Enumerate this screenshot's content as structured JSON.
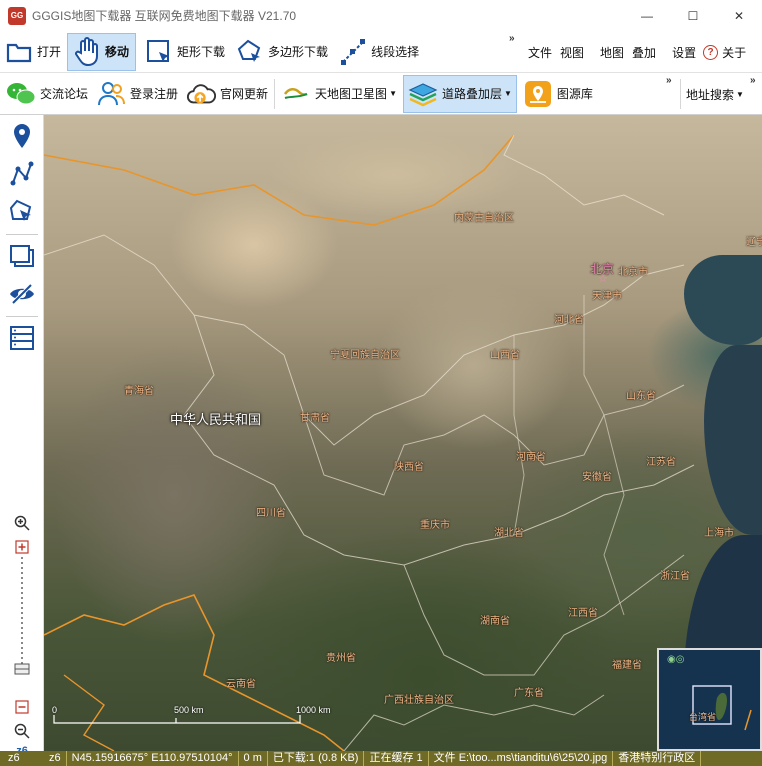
{
  "window": {
    "title": "GGGIS地图下载器  互联网免费地图下载器 V21.70",
    "logo_text": "GG",
    "minimize": "—",
    "maximize": "☐",
    "close": "✕"
  },
  "toolbar": {
    "open": "打开",
    "move": "移动",
    "rect_download": "矩形下载",
    "polygon_download": "多边形下载",
    "line_select": "线段选择",
    "more": "»",
    "file": "文件",
    "view": "视图",
    "map": "地图",
    "overlay": "叠加",
    "settings": "设置",
    "about": "关于"
  },
  "toolbar2": {
    "forum": "交流论坛",
    "login": "登录注册",
    "update": "官网更新",
    "tianditu": "天地图卫星图",
    "road_overlay": "道路叠加层",
    "tile_library": "图源库",
    "more": "»",
    "address_search": "地址搜索",
    "more2": "»"
  },
  "sidebar": {
    "zoom_level": "z6"
  },
  "map": {
    "labels": [
      {
        "text": "内蒙古自治区",
        "type": "province"
      },
      {
        "text": "北京",
        "type": "capital"
      },
      {
        "text": "北京市",
        "type": "province"
      },
      {
        "text": "天津市",
        "type": "province"
      },
      {
        "text": "辽宁",
        "type": "province"
      },
      {
        "text": "河北省",
        "type": "province"
      },
      {
        "text": "宁夏回族自治区",
        "type": "province"
      },
      {
        "text": "山西省",
        "type": "province"
      },
      {
        "text": "山东省",
        "type": "province"
      },
      {
        "text": "青海省",
        "type": "province"
      },
      {
        "text": "中华人民共和国",
        "type": "country"
      },
      {
        "text": "甘肃省",
        "type": "province"
      },
      {
        "text": "陕西省",
        "type": "province"
      },
      {
        "text": "河南省",
        "type": "province"
      },
      {
        "text": "江苏省",
        "type": "province"
      },
      {
        "text": "安徽省",
        "type": "province"
      },
      {
        "text": "四川省",
        "type": "province"
      },
      {
        "text": "重庆市",
        "type": "province"
      },
      {
        "text": "湖北省",
        "type": "province"
      },
      {
        "text": "上海市",
        "type": "province"
      },
      {
        "text": "浙江省",
        "type": "province"
      },
      {
        "text": "湖南省",
        "type": "province"
      },
      {
        "text": "江西省",
        "type": "province"
      },
      {
        "text": "贵州省",
        "type": "province"
      },
      {
        "text": "福建省",
        "type": "province"
      },
      {
        "text": "云南省",
        "type": "province"
      },
      {
        "text": "广西壮族自治区",
        "type": "province"
      },
      {
        "text": "广东省",
        "type": "province"
      }
    ],
    "scale": {
      "zero": "0",
      "mid": "500 km",
      "end": "1000 km"
    },
    "minimap_label": "台湾省"
  },
  "statusbar": {
    "zoom": "z6",
    "coords": "N45.15916675° E110.97510104°",
    "distance": "0 m",
    "downloaded": "已下载:1 (0.8 KB)",
    "saving": "正在缓存 1",
    "file": "文件 E:\\too...ms\\tianditu\\6\\25\\20.jpg",
    "extra": "香港特别行政区"
  },
  "colors": {
    "accent": "#1f5fb0",
    "active_bg": "#cde3f7",
    "statusbar_bg": "#6f6a26",
    "boundary_orange": "#e8952c",
    "label_orange": "#f3b98a"
  }
}
